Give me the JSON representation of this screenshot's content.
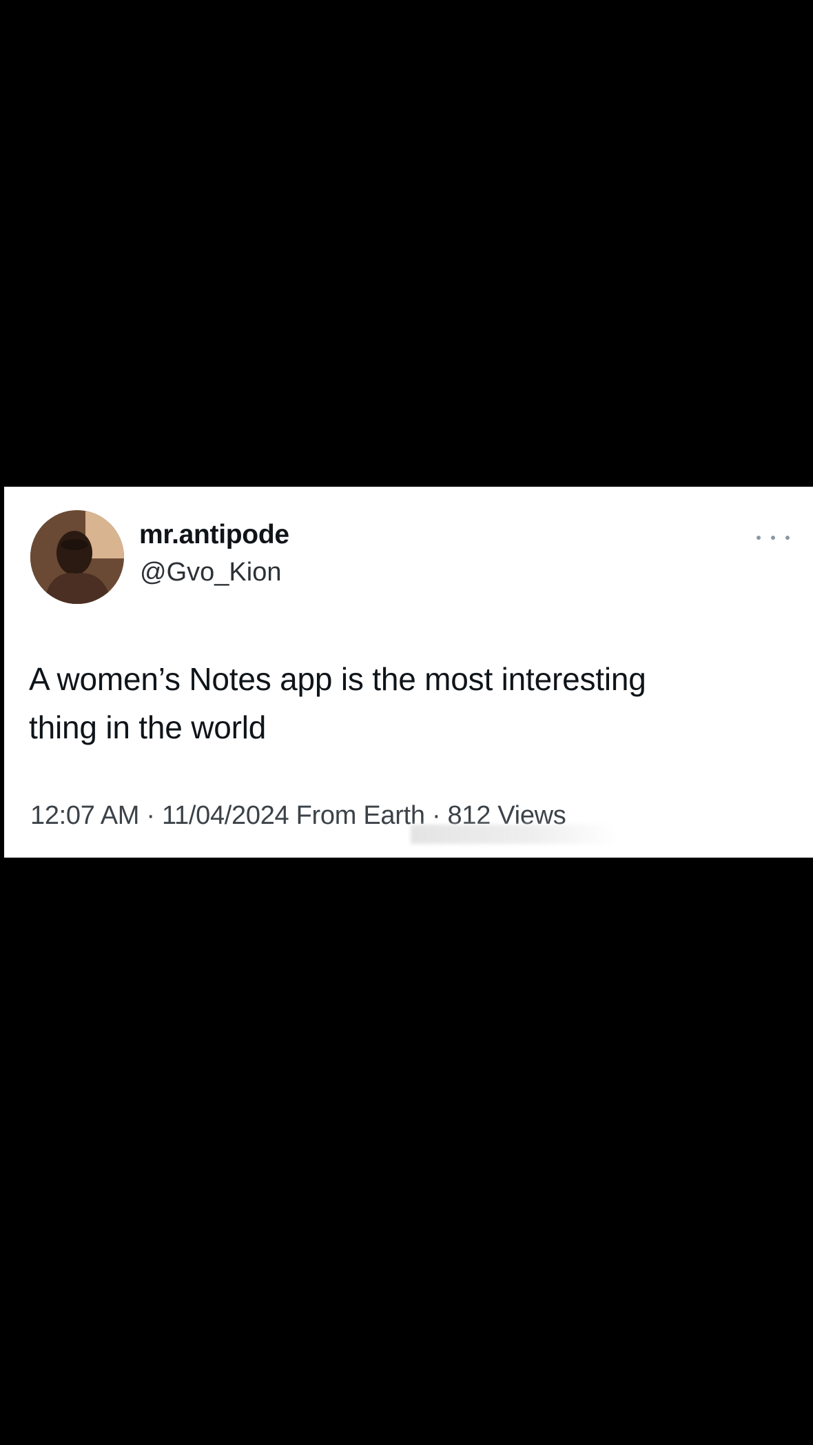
{
  "tweet": {
    "display_name": "mr.antipode",
    "handle": "@Gvo_Kion",
    "text_line_1": "A women’s Notes app is the most interesting",
    "text_line_2": "thing in the world",
    "meta": "12:07 AM · 11/04/2024 From Earth · 812 Views",
    "more_icon": "more-horizontal-icon",
    "avatar_icon": "profile-photo"
  },
  "colors": {
    "background": "#000000",
    "card": "#ffffff",
    "text_primary": "#0f1419",
    "text_secondary": "#3b4248"
  }
}
